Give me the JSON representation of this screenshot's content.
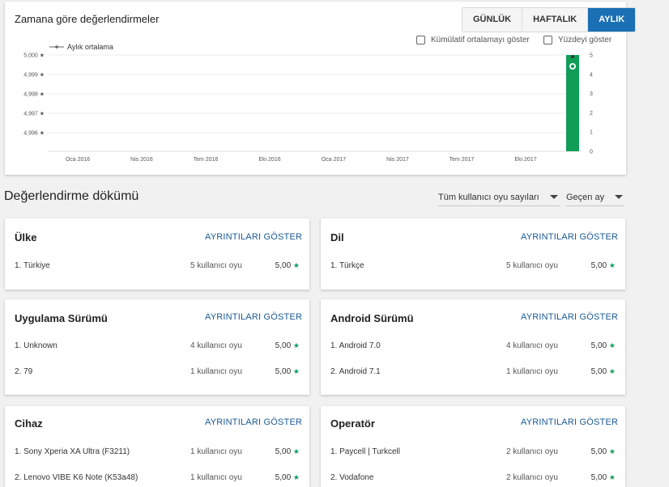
{
  "chart_card": {
    "title": "Zamana göre değerlendirmeler",
    "tabs": [
      {
        "label": "GÜNLÜK",
        "active": false
      },
      {
        "label": "HAFTALIK",
        "active": false
      },
      {
        "label": "AYLIK",
        "active": true
      }
    ],
    "checkboxes": {
      "cumulative": "Kümülatif ortalamayı göster",
      "percent": "Yüzdeyi göster"
    }
  },
  "chart_data": {
    "type": "bar",
    "legend": "Aylık ortalama",
    "x_tick_labels": [
      "Oca 2016",
      "Nis 2016",
      "Tem 2016",
      "Eki 2016",
      "Oca 2017",
      "Nis 2017",
      "Tem 2017",
      "Eki 2017"
    ],
    "left_axis": {
      "ticks": [
        "5,000 ★",
        "4,999 ★",
        "4,998 ★",
        "4,997 ★",
        "4,996 ★"
      ],
      "ylim": [
        4.995,
        5.0
      ]
    },
    "right_axis": {
      "ticks": [
        "5",
        "4",
        "3",
        "2",
        "1",
        "0"
      ],
      "ylim": [
        0,
        5
      ]
    },
    "bars": [
      {
        "x": "Ara 2017",
        "value": 5
      }
    ],
    "bar_color": "#0f9d58",
    "grid": true
  },
  "breakdown": {
    "title": "Değerlendirme dökümü",
    "filter_users": "Tüm kullanıcı oyu sayıları",
    "filter_period": "Geçen ay",
    "details_label": "AYRINTILARI GÖSTER",
    "panels": [
      {
        "title": "Ülke",
        "rows": [
          {
            "label": "1. Türkiye",
            "count": "5 kullanıcı oyu",
            "rating": "5,00"
          }
        ]
      },
      {
        "title": "Dil",
        "rows": [
          {
            "label": "1. Türkçe",
            "count": "5 kullanıcı oyu",
            "rating": "5,00"
          }
        ]
      },
      {
        "title": "Uygulama Sürümü",
        "rows": [
          {
            "label": "1. Unknown",
            "count": "4 kullanıcı oyu",
            "rating": "5,00"
          },
          {
            "label": "2. 79",
            "count": "1 kullanıcı oyu",
            "rating": "5,00"
          }
        ]
      },
      {
        "title": "Android Sürümü",
        "rows": [
          {
            "label": "1. Android 7.0",
            "count": "4 kullanıcı oyu",
            "rating": "5,00"
          },
          {
            "label": "2. Android 7.1",
            "count": "1 kullanıcı oyu",
            "rating": "5,00"
          }
        ]
      },
      {
        "title": "Cihaz",
        "rows": [
          {
            "label": "1. Sony Xperia XA Ultra (F3211)",
            "count": "1 kullanıcı oyu",
            "rating": "5,00"
          },
          {
            "label": "2. Lenovo VIBE K6 Note (K53a48)",
            "count": "1 kullanıcı oyu",
            "rating": "5,00"
          }
        ]
      },
      {
        "title": "Operatör",
        "rows": [
          {
            "label": "1. Paycell | Turkcell",
            "count": "2 kullanıcı oyu",
            "rating": "5,00"
          },
          {
            "label": "2. Vodafone",
            "count": "2 kullanıcı oyu",
            "rating": "5,00"
          }
        ]
      }
    ]
  }
}
